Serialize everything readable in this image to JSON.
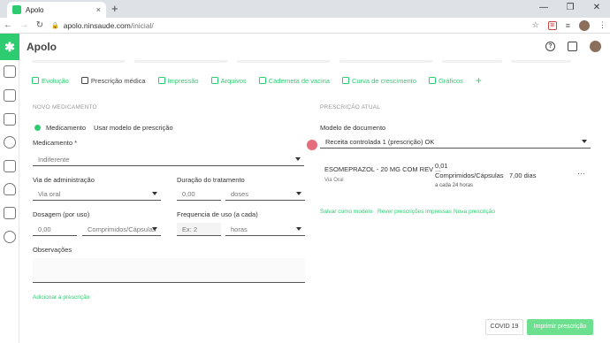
{
  "browser": {
    "tab_title": "Apolo",
    "tab_close": "×",
    "new_tab": "+",
    "url_host": "apolo.ninsaude.com",
    "url_path": "/inicial/",
    "ext_badge": "⊞",
    "win": {
      "min": "—",
      "max": "❐",
      "close": "✕"
    }
  },
  "app": {
    "logo_glyph": "✱",
    "name": "Apolo",
    "help": "?"
  },
  "tabs": [
    {
      "label": "Evolução"
    },
    {
      "label": "Prescrição médica"
    },
    {
      "label": "Impressão"
    },
    {
      "label": "Arquivos"
    },
    {
      "label": "Caderneta de vacina"
    },
    {
      "label": "Curva de crescimento"
    },
    {
      "label": "Gráficos"
    },
    {
      "label": "+"
    }
  ],
  "left": {
    "section": "NOVO MEDICAMENTO",
    "radio_med": "Medicamento",
    "radio_model": "Usar modelo de prescrição",
    "med_label": "Medicamento *",
    "med_value": "Indiferente",
    "via_label": "Via de administração",
    "via_value": "Via oral",
    "dur_label": "Duração do tratamento",
    "dur_value": "0,00",
    "dur_unit": "doses",
    "dose_label": "Dosagem (por uso)",
    "dose_value": "0,00",
    "dose_unit": "Comprimidos/Cápsulas",
    "freq_label": "Frequencia de uso (a cada)",
    "freq_placeholder": "Ex: 2",
    "freq_unit": "horas",
    "obs_label": "Observações",
    "add_link": "Adicionar à prescrição"
  },
  "right": {
    "section": "PRESCRIÇÃO ATUAL",
    "model_label": "Modelo de documento",
    "model_value": "Receita controlada 1 (prescrição) OK",
    "item": {
      "name": "ESOMEPRAZOL - 20 MG COM REV ...",
      "via": "Via Oral",
      "dose": "0,01",
      "unit": "Comprimidos/Cápsulas",
      "freq": "a cada 24 horas",
      "days": "7,00 dias",
      "more": "···"
    },
    "links": [
      "Salvar como modelo",
      "Rever prescrições impressas",
      "Nova prescrição"
    ]
  },
  "footer": {
    "covid": "COVID 19",
    "print": "Imprimir prescrição"
  },
  "colors": {
    "accent": "#2ecc71",
    "accent_light": "#6de08f",
    "highlight": "#d43c50"
  }
}
